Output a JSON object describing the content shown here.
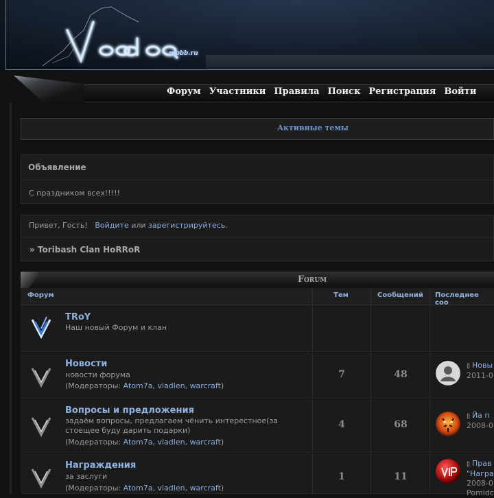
{
  "header": {
    "logo_alt": "Voodoo",
    "logo_sub": "mpbb.ru"
  },
  "nav": {
    "items": [
      "Форум",
      "Участники",
      "Правила",
      "Поиск",
      "Регистрация",
      "Войти"
    ]
  },
  "active_topics": "Активные темы",
  "announcement": {
    "title": "Объявление",
    "text": "С праздником всех!!!!!"
  },
  "welcome": {
    "greeting": "Привет, Гость!",
    "login": "Войдите",
    "or": "или",
    "register": "зарегистрируйтесь.",
    "crumb": "» Toribash Clan HoRRoR"
  },
  "forum": {
    "title": "Forum",
    "columns": {
      "forum": "Форум",
      "topics": "Тем",
      "posts": "Сообщений",
      "last": "Последнее соо"
    },
    "mods_label": "Модераторы:",
    "mods": [
      "Atom7a",
      "vladlen",
      "warcraft"
    ],
    "rows": [
      {
        "name": "TRoY",
        "desc": "Наш новый Форум и клан",
        "topics": "",
        "posts": "",
        "last_title": "",
        "last_date": ""
      },
      {
        "name": "Новости",
        "desc": "новости форума",
        "topics": "7",
        "posts": "48",
        "last_title": "Новы",
        "last_date": "2011-0"
      },
      {
        "name": "Вопросы и предложения",
        "desc": "задаём вопросы, предлагаем чёнить интерестное(за стоещее буду дарить подарки)",
        "topics": "4",
        "posts": "68",
        "last_title": "Йа п",
        "last_date": "2008-0"
      },
      {
        "name": "Награждения",
        "desc": "за заслуги",
        "topics": "1",
        "posts": "11",
        "last_title": "Прав",
        "last_title2": "\"Награ",
        "last_date": "2008-0",
        "last_by": "Pomidc"
      }
    ]
  },
  "colors": {
    "link": "#8aaee0",
    "heading_link": "#8fb1df",
    "background": "#121212",
    "panel": "#1c1c1c"
  }
}
